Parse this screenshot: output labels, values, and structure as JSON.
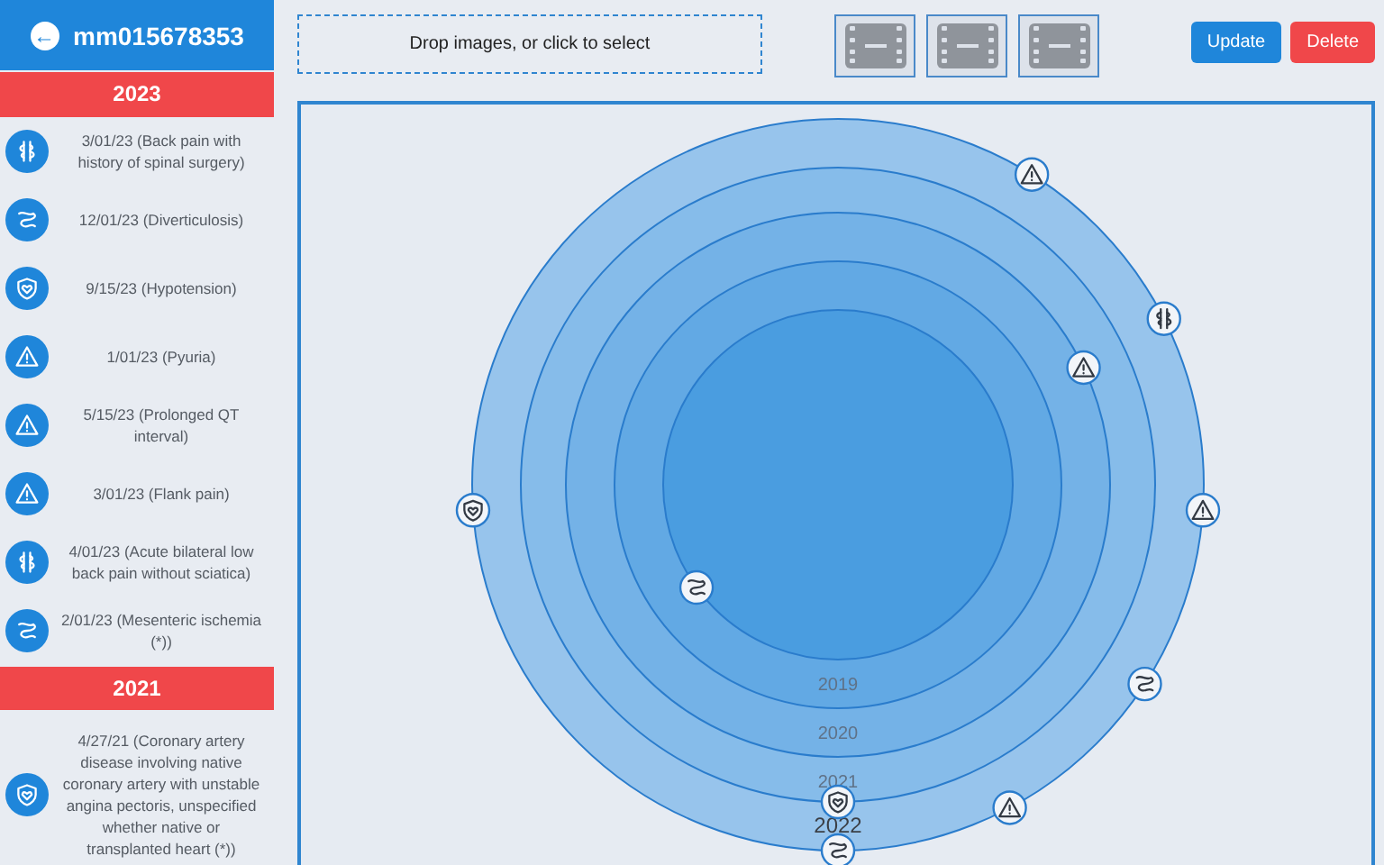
{
  "header": {
    "back_icon": "←",
    "title": "mm015678353"
  },
  "sidebar": {
    "groups": [
      {
        "year": "2023",
        "items": [
          {
            "kind": "spine",
            "text": "3/01/23 (Back pain with history of spinal surgery)"
          },
          {
            "kind": "intestine",
            "text": "12/01/23 (Diverticulosis)"
          },
          {
            "kind": "heart",
            "text": "9/15/23 (Hypotension)"
          },
          {
            "kind": "warning",
            "text": "1/01/23 (Pyuria)"
          },
          {
            "kind": "warning",
            "text": "5/15/23 (Prolonged QT interval)"
          },
          {
            "kind": "warning",
            "text": "3/01/23 (Flank pain)"
          },
          {
            "kind": "spine",
            "text": "4/01/23 (Acute bilateral low back pain without sciatica)"
          },
          {
            "kind": "intestine",
            "text": "2/01/23 (Mesenteric ischemia (*))"
          }
        ]
      },
      {
        "year": "2021",
        "items": [
          {
            "kind": "heart",
            "text": "4/27/21 (Coronary artery disease involving native coronary artery with unstable angina pectoris, unspecified whether native or transplanted heart (*))"
          }
        ]
      }
    ]
  },
  "toolbar": {
    "dropzone": "Drop images, or click to select",
    "videos": [
      {
        "kind": "film"
      },
      {
        "kind": "film"
      },
      {
        "kind": "film"
      }
    ],
    "buttons": [
      {
        "kind": "primary",
        "label": "Update"
      },
      {
        "kind": "danger",
        "label": "Delete"
      }
    ]
  },
  "timeline": {
    "rings": [
      {
        "label": "2019"
      },
      {
        "label": "2020"
      },
      {
        "label": "2021"
      },
      {
        "label": "2022"
      }
    ],
    "markers": [
      {
        "kind": "warning"
      },
      {
        "kind": "spine"
      },
      {
        "kind": "warning"
      },
      {
        "kind": "heart"
      },
      {
        "kind": "warning"
      },
      {
        "kind": "intestine"
      },
      {
        "kind": "intestine"
      },
      {
        "kind": "heart"
      },
      {
        "kind": "warning"
      },
      {
        "kind": "intestine"
      }
    ]
  }
}
